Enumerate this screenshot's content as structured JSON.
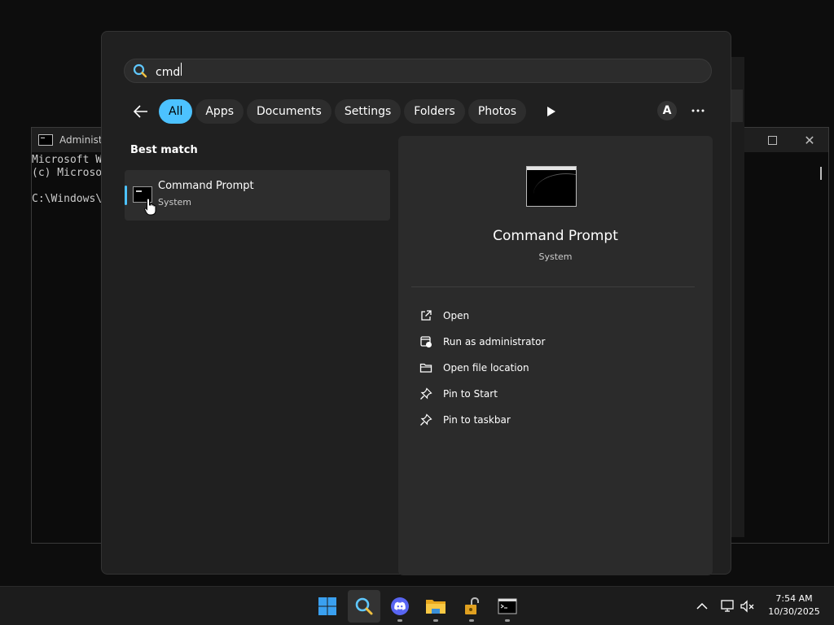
{
  "console": {
    "title": "Administra",
    "lines": [
      "Microsoft W",
      "(c) Microso",
      "",
      "C:\\Windows\\"
    ]
  },
  "search": {
    "query": "cmd",
    "filters": [
      {
        "label": "All",
        "active": true
      },
      {
        "label": "Apps"
      },
      {
        "label": "Documents"
      },
      {
        "label": "Settings"
      },
      {
        "label": "Folders"
      },
      {
        "label": "Photos"
      }
    ],
    "account_initial": "A"
  },
  "results": {
    "section_label": "Best match",
    "best_match": {
      "title": "Command Prompt",
      "subtitle": "System"
    }
  },
  "detail": {
    "title": "Command Prompt",
    "subtitle": "System",
    "actions": [
      {
        "label": "Open",
        "icon": "open-external-icon"
      },
      {
        "label": "Run as administrator",
        "icon": "shield-window-icon"
      },
      {
        "label": "Open file location",
        "icon": "folder-icon"
      },
      {
        "label": "Pin to Start",
        "icon": "pin-icon"
      },
      {
        "label": "Pin to taskbar",
        "icon": "pin-icon"
      }
    ]
  },
  "taskbar": {
    "apps": [
      "start-icon",
      "search-icon",
      "discord-icon",
      "file-explorer-icon",
      "lock-app-icon",
      "command-prompt-icon"
    ],
    "clock": {
      "time": "7:54 AM",
      "date": "10/30/2025"
    }
  },
  "colors": {
    "accent": "#4cc2ff",
    "panel": "#202020",
    "pane": "#2b2b2b"
  }
}
